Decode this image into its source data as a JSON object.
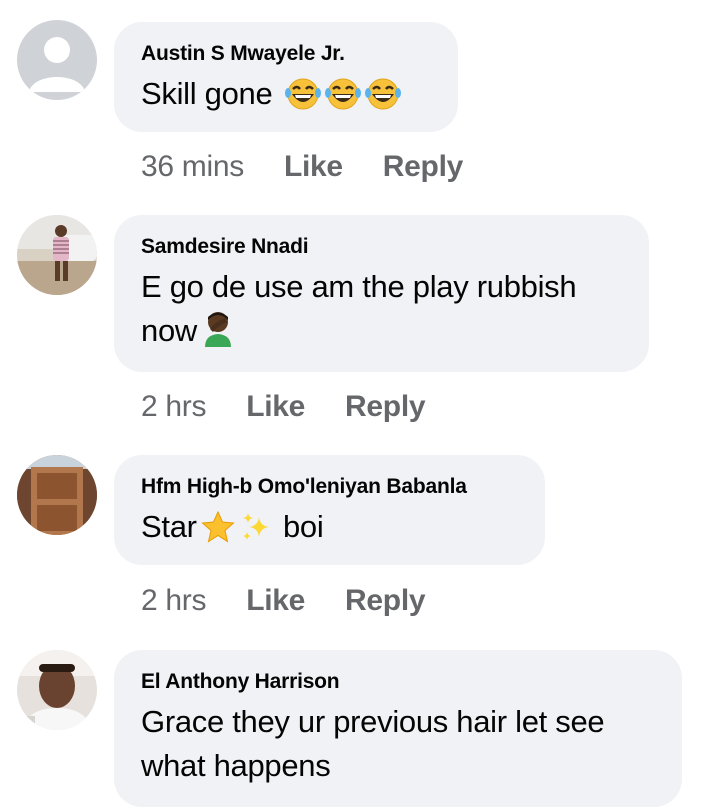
{
  "comments": [
    {
      "author": "Austin S Mwayele Jr.",
      "text": "Skill gone",
      "emoji": [
        "face-with-tears-of-joy-icon",
        "face-with-tears-of-joy-icon",
        "face-with-tears-of-joy-icon"
      ],
      "time": "36 mins",
      "like_label": "Like",
      "reply_label": "Reply",
      "avatar": "default-avatar-icon"
    },
    {
      "author": "Samdesire Nnadi",
      "text_line1": "E go de use am the play rubbish",
      "text_line2": "now",
      "emoji": [
        "person-facepalming-icon"
      ],
      "time": "2 hrs",
      "like_label": "Like",
      "reply_label": "Reply",
      "avatar": "photo-avatar"
    },
    {
      "author": "Hfm High-b Omo'leniyan Babanla",
      "text_before": "Star",
      "text_after": "boi",
      "emoji": [
        "star-icon",
        "sparkles-icon"
      ],
      "time": "2 hrs",
      "like_label": "Like",
      "reply_label": "Reply",
      "avatar": "photo-avatar"
    },
    {
      "author": "El Anthony Harrison",
      "text_line1": "Grace they ur previous hair let see",
      "text_line2": "what happens",
      "avatar": "photo-avatar"
    }
  ],
  "colors": {
    "bubble": "#f0f2f5",
    "meta_text": "#65676b",
    "body_text": "#050505",
    "default_avatar": "#cfd2d7"
  }
}
